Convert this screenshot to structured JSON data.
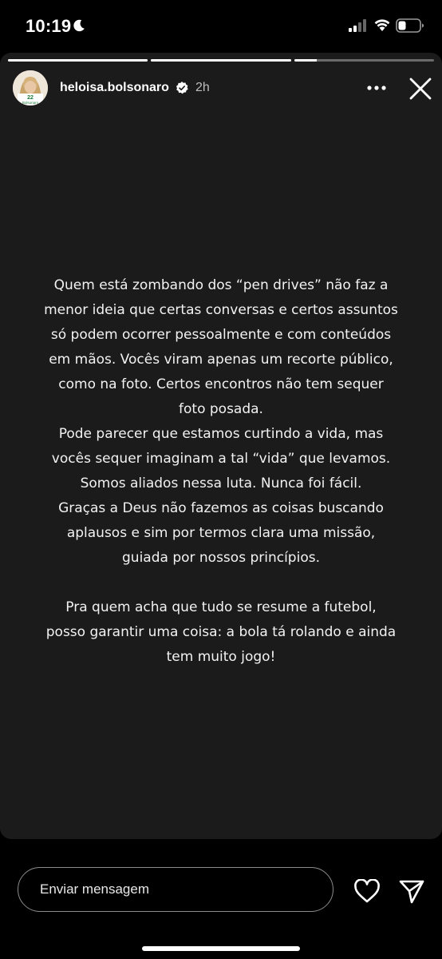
{
  "status_bar": {
    "time": "10:19",
    "icons": [
      "moon-icon",
      "signal-icon",
      "wifi-icon",
      "battery-icon"
    ]
  },
  "story": {
    "progress": [
      1.0,
      1.0,
      0.16
    ],
    "user": {
      "username": "heloisa.bolsonaro",
      "verified": true,
      "time_ago": "2h",
      "avatar_badge_text": "22",
      "avatar_badge_subtext": "Bolsonaro"
    },
    "text_paragraphs": [
      "Quem está zombando dos “pen drives” não faz a menor ideia que certas conversas e certos assuntos só podem ocorrer pessoalmente e com conteúdos em mãos. Vocês viram apenas um recorte público, como na foto. Certos encontros não tem sequer foto posada.",
      "Pode parecer que estamos curtindo a vida, mas vocês sequer imaginam a tal “vida” que levamos.",
      "Somos aliados nessa luta. Nunca foi fácil.",
      "Graças a Deus não fazemos as coisas buscando aplausos e sim por termos clara uma missão, guiada por nossos princípios.",
      "",
      "Pra quem acha que tudo se resume a futebol, posso garantir uma coisa: a bola tá rolando e ainda tem muito jogo!"
    ]
  },
  "reply_bar": {
    "placeholder": "Enviar mensagem",
    "icons": [
      "heart-icon",
      "send-icon"
    ]
  },
  "colors": {
    "background": "#000000",
    "story_background": "#1b1b1b",
    "text": "#f2f2f2",
    "muted": "#bdbdbd",
    "verified_badge": "#ffffff"
  }
}
